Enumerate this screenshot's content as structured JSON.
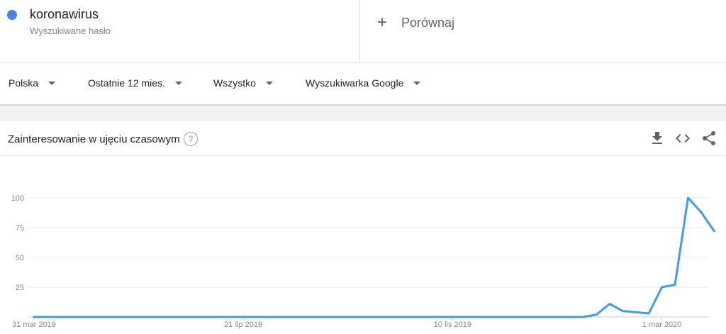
{
  "term": {
    "name": "koronawirus",
    "subtitle": "Wyszukiwane hasło",
    "color": "#4285f4"
  },
  "compare": {
    "icon": "plus-icon",
    "label": "Porównaj"
  },
  "filters": {
    "region": "Polska",
    "period": "Ostatnie 12 mies.",
    "category": "Wszystko",
    "source": "Wyszukiwarka Google"
  },
  "card": {
    "title": "Zainteresowanie w ujęciu czasowym",
    "help_icon": "question-mark-icon",
    "help_glyph": "?",
    "tools": {
      "download": "download-icon",
      "embed": "embed-code-icon",
      "share": "share-icon"
    }
  },
  "chart_data": {
    "type": "line",
    "y_ticks": [
      25,
      50,
      75,
      100
    ],
    "ylim": [
      0,
      100
    ],
    "x_tick_labels": [
      "31 mar 2019",
      "21 lip 2019",
      "10 lis 2019",
      "1 mar 2020"
    ],
    "x_tick_weeks": [
      0,
      16,
      32,
      48
    ],
    "grid": true,
    "series": [
      {
        "color": "#3a9ee8",
        "values": [
          0,
          0,
          0,
          0,
          0,
          0,
          0,
          0,
          0,
          0,
          0,
          0,
          0,
          0,
          0,
          0,
          0,
          0,
          0,
          0,
          0,
          0,
          0,
          0,
          0,
          0,
          0,
          0,
          0,
          0,
          0,
          0,
          0,
          0,
          0,
          0,
          0,
          0,
          0,
          0,
          0,
          0,
          0,
          2,
          11,
          5,
          4,
          3,
          25,
          27,
          100,
          88,
          72
        ]
      }
    ]
  }
}
